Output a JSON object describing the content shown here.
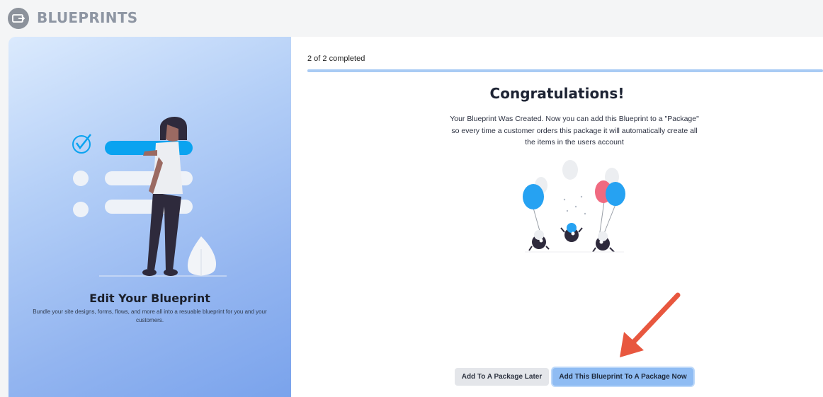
{
  "app": {
    "title": "BLUEPRINTS",
    "logo_icon": "blueprint-logo-icon"
  },
  "left_panel": {
    "title": "Edit Your Blueprint",
    "description": "Bundle your site designs, forms, flows, and more all into a resuable blueprint for you and your customers.",
    "illustration": "woman-checklist-illustration"
  },
  "wizard": {
    "progress_text": "2 of 2 completed",
    "progress_fraction": 1.0,
    "title": "Congratulations!",
    "body": "Your Blueprint Was Created. Now you can add this Blueprint to a \"Package\" so every time a customer orders this package it will automatically create all the items in the users account",
    "illustration": "balloons-celebration-illustration"
  },
  "buttons": {
    "later_label": "Add To A Package Later",
    "now_label": "Add This Blueprint To A Package Now"
  },
  "colors": {
    "accent": "#8fbcf3",
    "annotation_arrow": "#e8573f",
    "left_gradient_start": "#dbeafd",
    "left_gradient_end": "#7aa3ec"
  }
}
